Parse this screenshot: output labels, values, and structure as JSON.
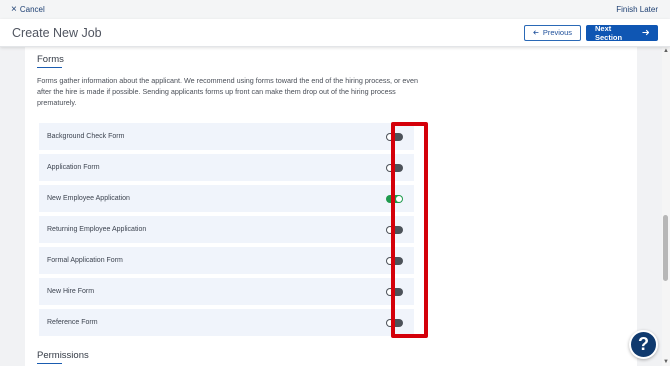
{
  "topbar": {
    "cancel_icon": "close-icon",
    "cancel_label": "Cancel",
    "finish_label": "Finish Later"
  },
  "header": {
    "title": "Create New Job",
    "previous_label": "Previous",
    "next_label": "Next Section"
  },
  "forms": {
    "title": "Forms",
    "description": "Forms gather information about the applicant. We recommend using forms toward the end of the hiring process, or even after the hire is made if possible. Sending applicants forms up front can make them drop out of the hiring process prematurely.",
    "items": [
      {
        "label": "Background Check Form",
        "enabled": false
      },
      {
        "label": "Application Form",
        "enabled": false
      },
      {
        "label": "New Employee Application",
        "enabled": true
      },
      {
        "label": "Returning Employee Application",
        "enabled": false
      },
      {
        "label": "Formal Application Form",
        "enabled": false
      },
      {
        "label": "New Hire Form",
        "enabled": false
      },
      {
        "label": "Reference Form",
        "enabled": false
      }
    ]
  },
  "permissions": {
    "title": "Permissions"
  },
  "help": {
    "label": "?"
  },
  "colors": {
    "primary": "#0f56b3",
    "toggle_on": "#1f9a4d",
    "toggle_off": "#4d5259",
    "highlight": "#d4000a",
    "help_button": "#103a6e"
  }
}
